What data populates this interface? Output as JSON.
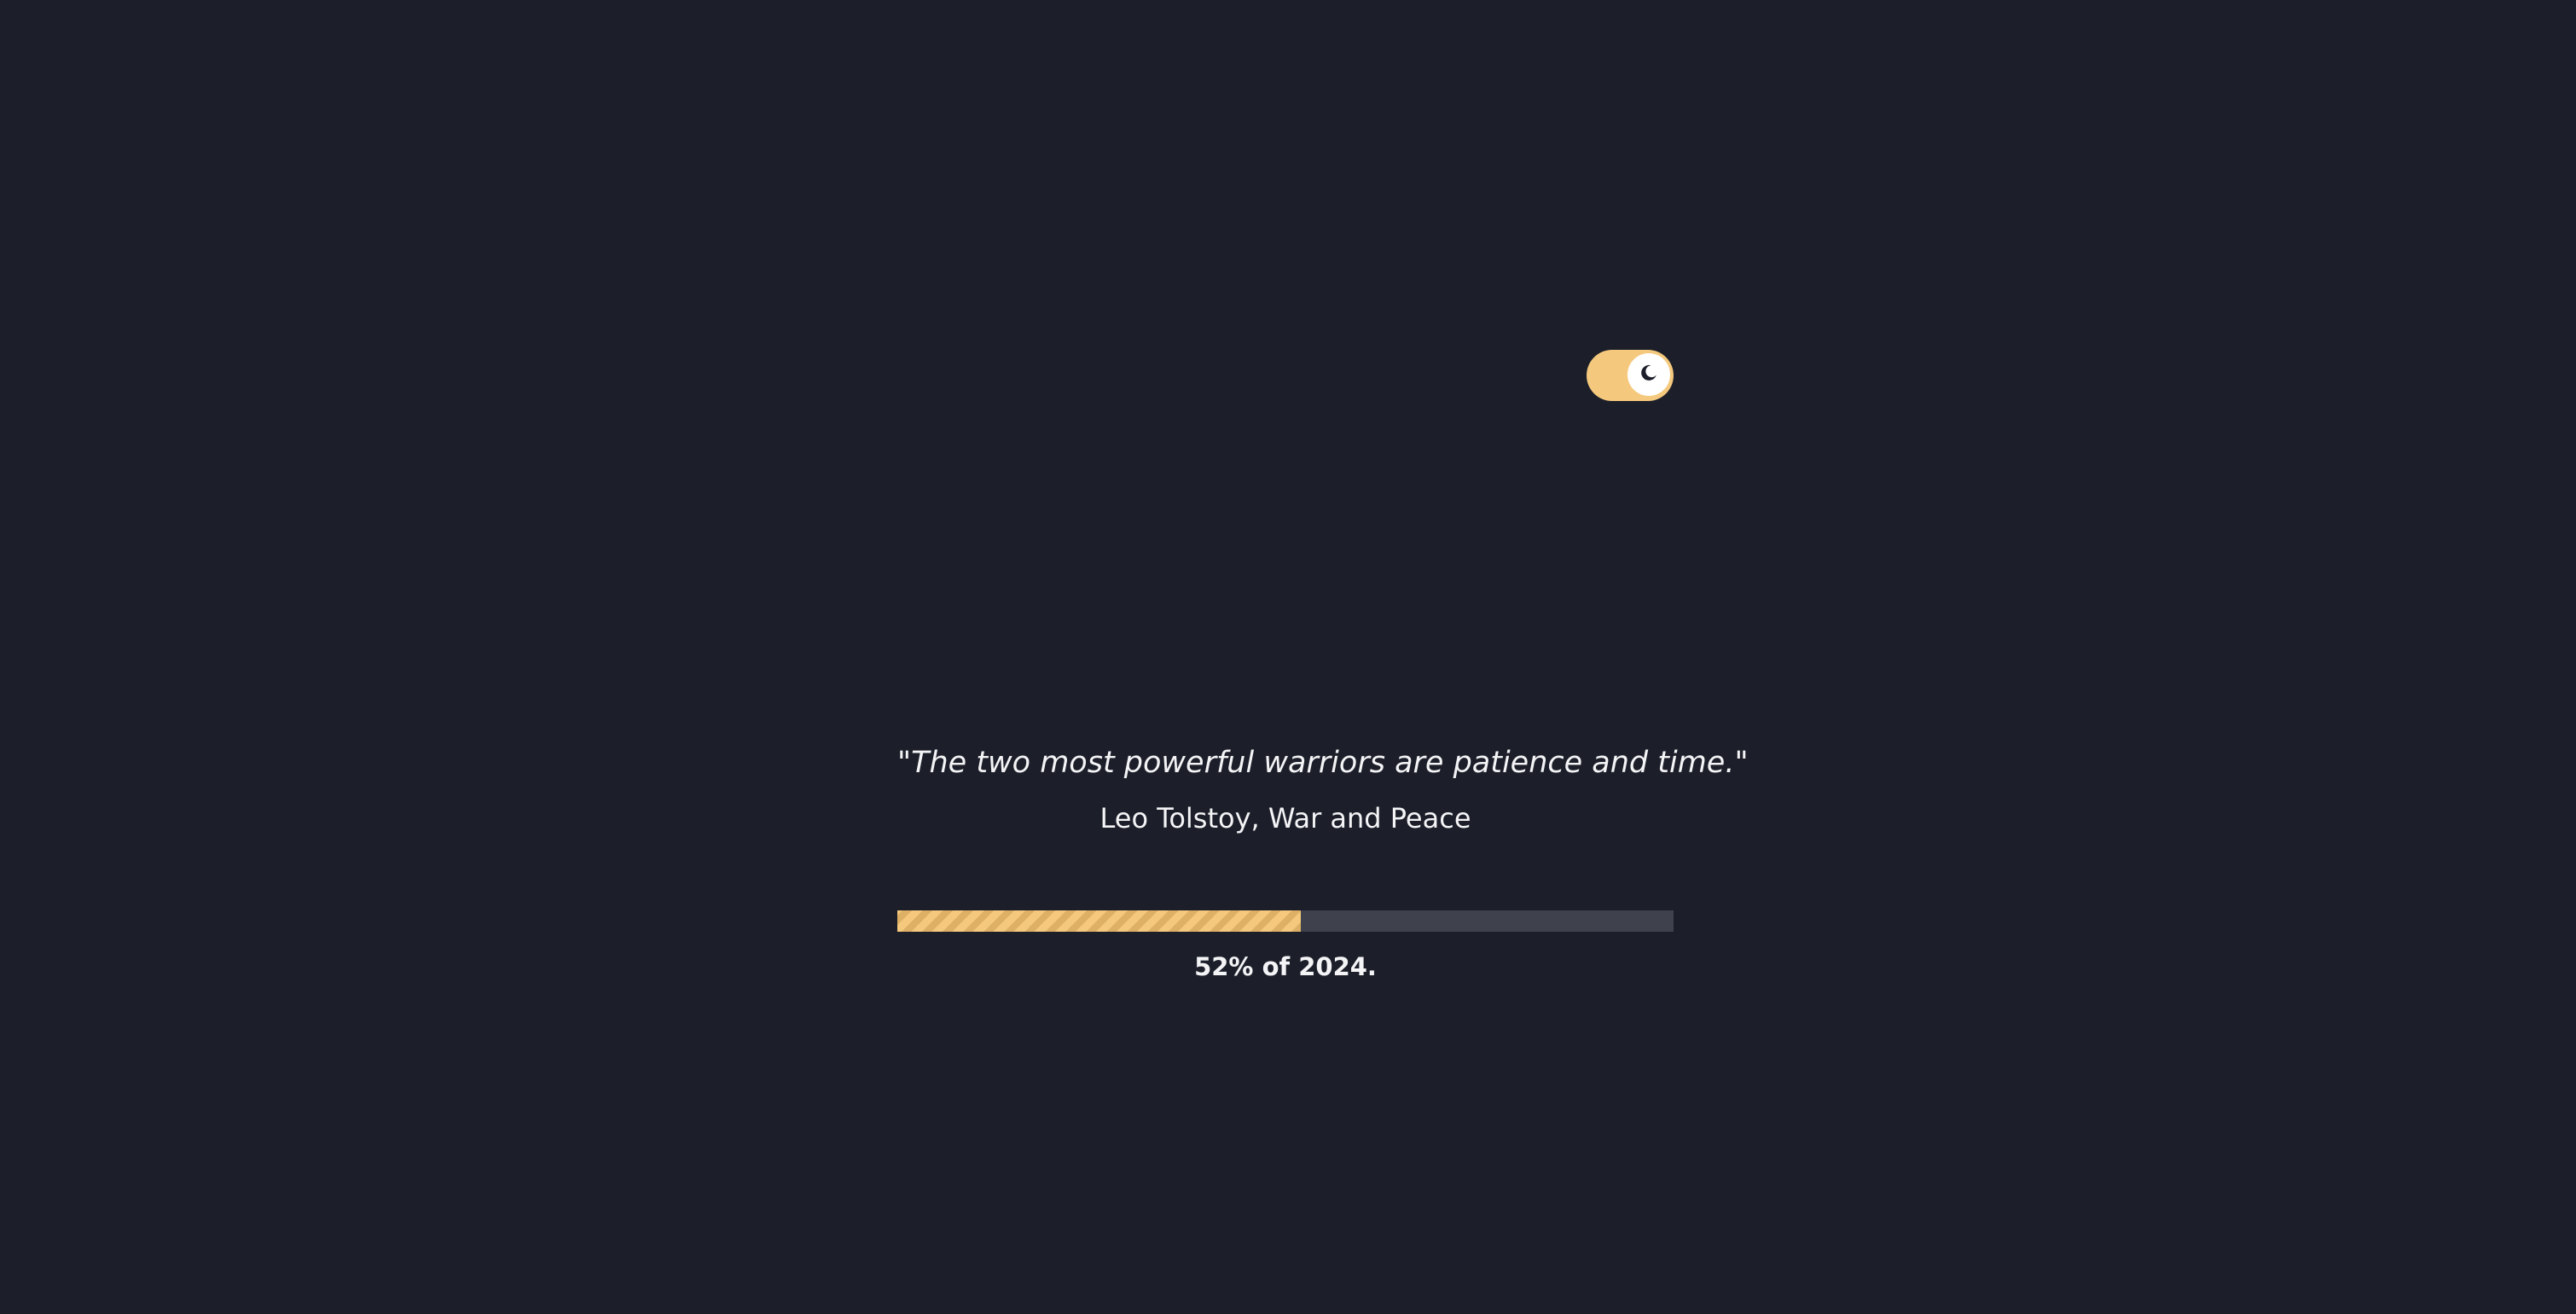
{
  "theme_toggle": {
    "state": "dark",
    "icon": "moon-icon",
    "track_color": "#f5c97d",
    "knob_color": "#ffffff"
  },
  "quote": {
    "text": "\"The two most powerful warriors are patience and time.\"",
    "attribution": "Leo Tolstoy, War and Peace"
  },
  "year_progress": {
    "percent": 52,
    "label": "52% of 2024.",
    "fill_color": "#f5c97d",
    "track_color": "#3f424c"
  },
  "colors": {
    "background": "#1c1f2a",
    "text": "#f4f4f6"
  }
}
